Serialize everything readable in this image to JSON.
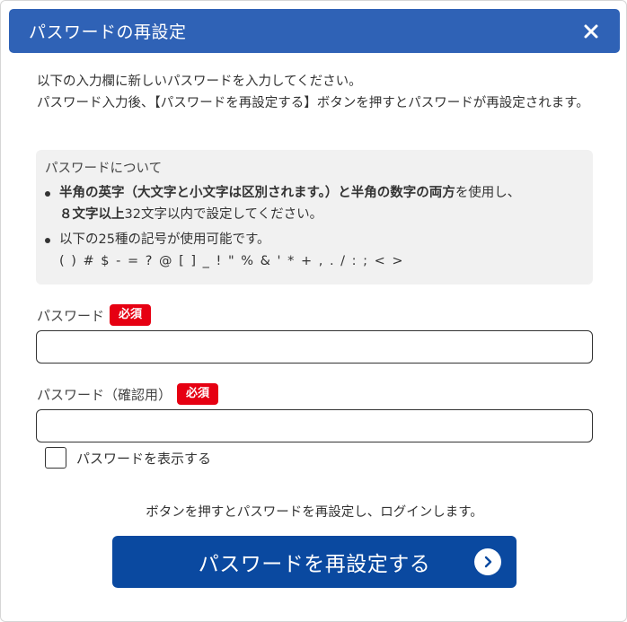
{
  "colors": {
    "header_bg": "#2f62b6",
    "button_bg": "#0a49a0",
    "required_badge": "#e60012",
    "notice_bg": "#f1f1f1"
  },
  "dialog": {
    "title": "パスワードの再設定",
    "close_icon": "close-icon"
  },
  "intro": {
    "line1": "以下の入力欄に新しいパスワードを入力してください。",
    "line2": "パスワード入力後、【パスワードを再設定する】ボタンを押すとパスワードが再設定されます。"
  },
  "notice": {
    "title": "パスワードについて",
    "rule1": {
      "part1_bold": "半角の英字（大文字と小文字は区別されます。）と半角の数字の両方",
      "part2": "を使用し、",
      "part3_bold": "８文字以上",
      "part4": "32文字以内で設定してください。"
    },
    "rule2": {
      "text": "以下の25種の記号が使用可能です。",
      "symbols": "( ) # $ - = ? @ [ ] _ ! \" % & ' * + , . / : ; < >"
    }
  },
  "form": {
    "password_label": "パスワード",
    "password_confirm_label": "パスワード（確認用）",
    "required_badge": "必須",
    "password_value": "",
    "password_confirm_value": "",
    "show_password_label": "パスワードを表示する",
    "show_password_checked": false
  },
  "footer": {
    "note": "ボタンを押すとパスワードを再設定し、ログインします。",
    "submit_label": "パスワードを再設定する",
    "submit_icon": "chevron-right-circle-icon"
  }
}
